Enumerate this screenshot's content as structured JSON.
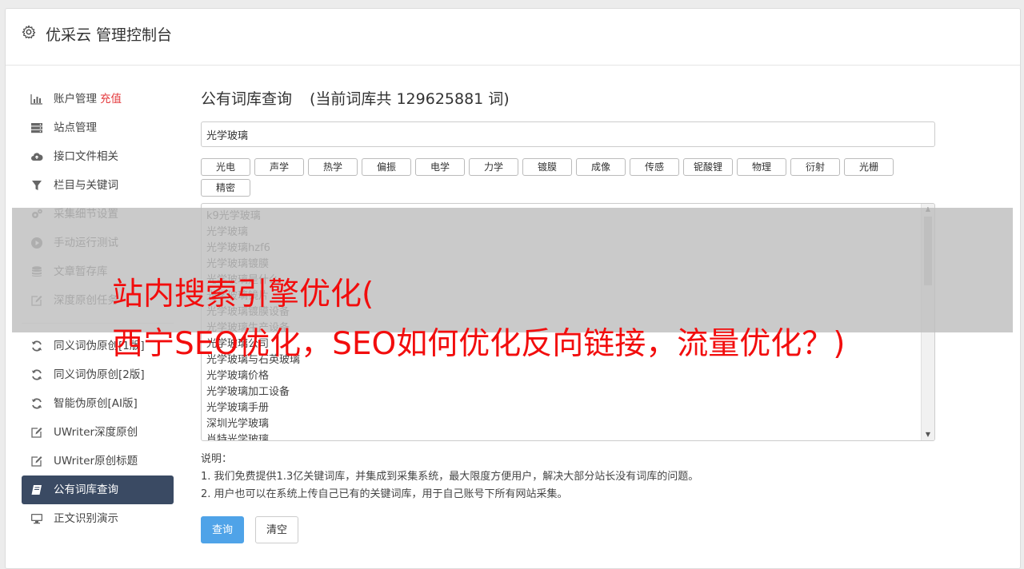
{
  "header": {
    "title": "优采云 管理控制台"
  },
  "sidebar": {
    "items_top": [
      {
        "label": "账户管理",
        "badge": "充值",
        "icon": "bar-chart-icon"
      },
      {
        "label": "站点管理",
        "icon": "server-icon"
      },
      {
        "label": "接口文件相关",
        "icon": "cloud-upload-icon"
      },
      {
        "label": "栏目与关键词",
        "icon": "filter-icon"
      },
      {
        "label": "采集细节设置",
        "icon": "gears-icon"
      },
      {
        "label": "手动运行测试",
        "icon": "play-circle-icon"
      },
      {
        "label": "文章暂存库",
        "icon": "database-icon"
      },
      {
        "label": "深度原创任务",
        "icon": "edit-icon"
      }
    ],
    "items_bottom": [
      {
        "label": "同义词伪原创[1版]",
        "icon": "refresh-icon"
      },
      {
        "label": "同义词伪原创[2版]",
        "icon": "refresh-icon"
      },
      {
        "label": "智能伪原创[AI版]",
        "icon": "refresh-icon"
      },
      {
        "label": "UWriter深度原创",
        "icon": "edit-icon"
      },
      {
        "label": "UWriter原创标题",
        "icon": "edit-icon"
      },
      {
        "label": "公有词库查询",
        "icon": "book-icon",
        "active": true
      },
      {
        "label": "正文识别演示",
        "icon": "desktop-icon"
      }
    ]
  },
  "main": {
    "title": "公有词库查询",
    "count_text": "(当前词库共 129625881 词)",
    "search_value": "光学玻璃",
    "tags": [
      "光电",
      "声学",
      "热学",
      "偏振",
      "电学",
      "力学",
      "镀膜",
      "成像",
      "传感",
      "铌酸锂",
      "物理",
      "衍射",
      "光栅",
      "精密"
    ],
    "results": [
      "k9光学玻璃",
      "光学玻璃",
      "光学玻璃hzf6",
      "光学玻璃镀膜",
      "光学玻璃是什么",
      "光学玻璃镜片",
      "光学玻璃镀膜设备",
      "光学玻璃生产设备",
      "光学玻璃公司",
      "光学玻璃与石英玻璃",
      "光学玻璃价格",
      "光学玻璃加工设备",
      "光学玻璃手册",
      "深圳光学玻璃",
      "肖特光学玻璃"
    ],
    "notes_title": "说明：",
    "notes": [
      "1. 我们免费提供1.3亿关键词库，并集成到采集系统，最大限度方便用户，解决大部分站长没有词库的问题。",
      "2. 用户也可以在系统上传自己已有的关键词库，用于自己账号下所有网站采集。"
    ],
    "query_button": "查询",
    "clear_button": "清空"
  },
  "overlay": {
    "line1": "站内搜索引擎优化(",
    "line2": "西宁SEO优化，SEO如何优化反向链接，流量优化？)"
  }
}
